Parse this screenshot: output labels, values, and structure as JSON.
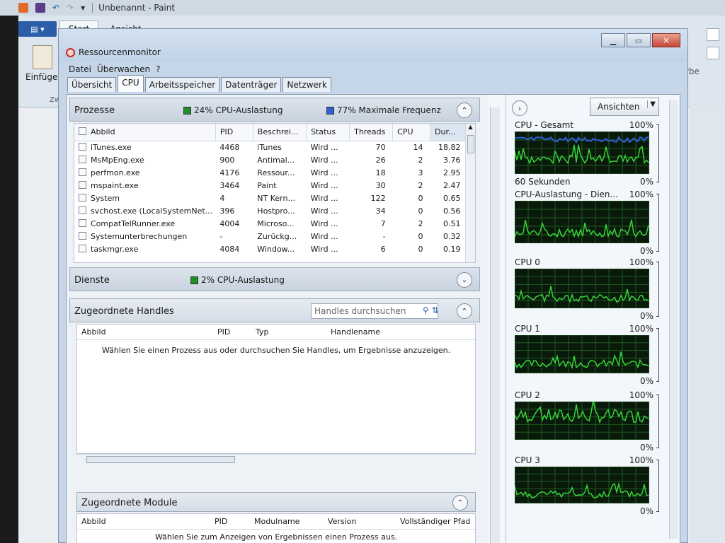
{
  "paint": {
    "title": "Unbenannt - Paint",
    "tabs": [
      "Start",
      "Ansicht"
    ],
    "paste_label": "Einfüge",
    "zw_label": "Zw",
    "right_label": "rbe"
  },
  "window": {
    "title": "Ressourcenmonitor",
    "menu": [
      "Datei",
      "Überwachen",
      "?"
    ],
    "tabs": [
      "Übersicht",
      "CPU",
      "Arbeitsspeicher",
      "Datenträger",
      "Netzwerk"
    ],
    "active_tab": "CPU"
  },
  "processes": {
    "header": "Prozesse",
    "cpu_usage": "24% CPU-Auslastung",
    "max_freq": "77% Maximale Frequenz",
    "columns": [
      "Abbild",
      "PID",
      "Beschrei...",
      "Status",
      "Threads",
      "CPU",
      "Dur..."
    ],
    "rows": [
      {
        "name": "iTunes.exe",
        "pid": "4468",
        "desc": "iTunes",
        "status": "Wird ...",
        "threads": "70",
        "cpu": "14",
        "avg": "18.82"
      },
      {
        "name": "MsMpEng.exe",
        "pid": "900",
        "desc": "Antimal...",
        "status": "Wird ...",
        "threads": "26",
        "cpu": "2",
        "avg": "3.76"
      },
      {
        "name": "perfmon.exe",
        "pid": "4176",
        "desc": "Ressour...",
        "status": "Wird ...",
        "threads": "18",
        "cpu": "3",
        "avg": "2.95"
      },
      {
        "name": "mspaint.exe",
        "pid": "3464",
        "desc": "Paint",
        "status": "Wird ...",
        "threads": "30",
        "cpu": "2",
        "avg": "2.47"
      },
      {
        "name": "System",
        "pid": "4",
        "desc": "NT Kern...",
        "status": "Wird ...",
        "threads": "122",
        "cpu": "0",
        "avg": "0.65"
      },
      {
        "name": "svchost.exe (LocalSystemNet...",
        "pid": "396",
        "desc": "Hostpro...",
        "status": "Wird ...",
        "threads": "34",
        "cpu": "0",
        "avg": "0.56"
      },
      {
        "name": "CompatTelRunner.exe",
        "pid": "4004",
        "desc": "Microso...",
        "status": "Wird ...",
        "threads": "7",
        "cpu": "2",
        "avg": "0.51"
      },
      {
        "name": "Systemunterbrechungen",
        "pid": "-",
        "desc": "Zurückg...",
        "status": "Wird ...",
        "threads": "-",
        "cpu": "0",
        "avg": "0.32"
      },
      {
        "name": "taskmgr.exe",
        "pid": "4084",
        "desc": "Window...",
        "status": "Wird ...",
        "threads": "6",
        "cpu": "0",
        "avg": "0.19"
      }
    ]
  },
  "services": {
    "header": "Dienste",
    "cpu_usage": "2% CPU-Auslastung"
  },
  "handles": {
    "header": "Zugeordnete Handles",
    "search_placeholder": "Handles durchsuchen",
    "columns": [
      "Abbild",
      "PID",
      "Typ",
      "Handlename"
    ],
    "message": "Wählen Sie einen Prozess aus oder durchsuchen Sie Handles, um Ergebnisse anzuzeigen."
  },
  "modules": {
    "header": "Zugeordnete Module",
    "columns": [
      "Abbild",
      "PID",
      "Modulname",
      "Version",
      "Vollständiger Pfad"
    ],
    "message": "Wählen Sie zum Anzeigen von Ergebnissen einen Prozess aus."
  },
  "graphs_panel": {
    "views_label": "Ansichten",
    "graphs": [
      {
        "title": "CPU - Gesamt",
        "max": "100%",
        "min": "0%",
        "bottom_left": "60 Sekunden"
      },
      {
        "title": "CPU-Auslastung - Dien...",
        "max": "100%",
        "min": "0%",
        "bottom_left": ""
      },
      {
        "title": "CPU 0",
        "max": "100%",
        "min": "0%",
        "bottom_left": ""
      },
      {
        "title": "CPU 1",
        "max": "100%",
        "min": "0%",
        "bottom_left": ""
      },
      {
        "title": "CPU 2",
        "max": "100%",
        "min": "0%",
        "bottom_left": ""
      },
      {
        "title": "CPU 3",
        "max": "100%",
        "min": "0%",
        "bottom_left": ""
      }
    ]
  },
  "colors": {
    "cpu_usage_swatch": "#1f8f2a",
    "max_freq_swatch": "#2e5fd6",
    "graph_bg": "#0a1a0a",
    "graph_line": "#37d33a"
  }
}
